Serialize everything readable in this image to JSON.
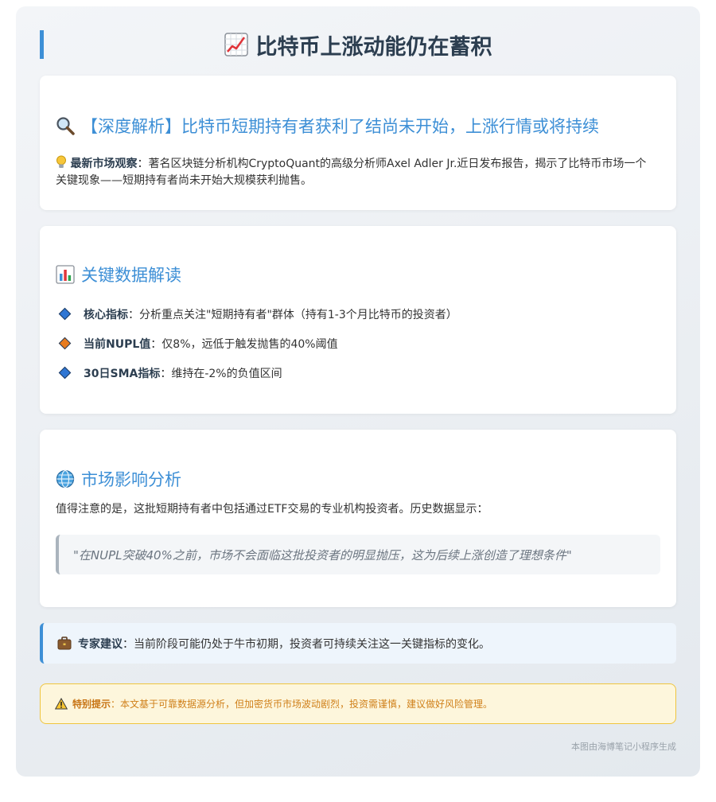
{
  "title": "比特币上涨动能仍在蓄积",
  "icons": {
    "title": "chart-increasing-icon",
    "section1": "magnifying-glass-icon",
    "observation": "light-bulb-icon",
    "section2": "bar-chart-icon",
    "section3": "globe-icon",
    "advice": "briefcase-icon",
    "warning": "warning-icon"
  },
  "colors": {
    "accent": "#3d8fd6",
    "title": "#2c3e50",
    "diamond_blue": "#2f76d4",
    "diamond_orange": "#e87b1e",
    "warning_text": "#d0801a",
    "warning_border": "#efc53f"
  },
  "section1": {
    "heading": "【深度解析】比特币短期持有者获利了结尚未开始，上涨行情或将持续",
    "label": "最新市场观察",
    "text": "：著名区块链分析机构CryptoQuant的高级分析师Axel Adler Jr.近日发布报告，揭示了比特币市场一个关键现象——短期持有者尚未开始大规模获利抛售。"
  },
  "section2": {
    "heading": "关键数据解读",
    "items": [
      {
        "label": "核心指标",
        "text": "：分析重点关注\"短期持有者\"群体（持有1-3个月比特币的投资者）",
        "marker": "blue"
      },
      {
        "label": "当前NUPL值",
        "text": "：仅8%，远低于触发抛售的40%阈值",
        "marker": "orange"
      },
      {
        "label": "30日SMA指标",
        "text": "：维持在-2%的负值区间",
        "marker": "blue"
      }
    ]
  },
  "section3": {
    "heading": "市场影响分析",
    "text": "值得注意的是，这批短期持有者中包括通过ETF交易的专业机构投资者。历史数据显示：",
    "quote": "\"在NUPL突破40%之前，市场不会面临这批投资者的明显抛压，这为后续上涨创造了理想条件\""
  },
  "advice": {
    "label": "专家建议",
    "text": "：当前阶段可能仍处于牛市初期，投资者可持续关注这一关键指标的变化。"
  },
  "warning": {
    "label": "特别提示",
    "text": "：本文基于可靠数据源分析，但加密货币市场波动剧烈，投资需谨慎，建议做好风险管理。"
  },
  "footer": "本图由海博笔记小程序生成"
}
